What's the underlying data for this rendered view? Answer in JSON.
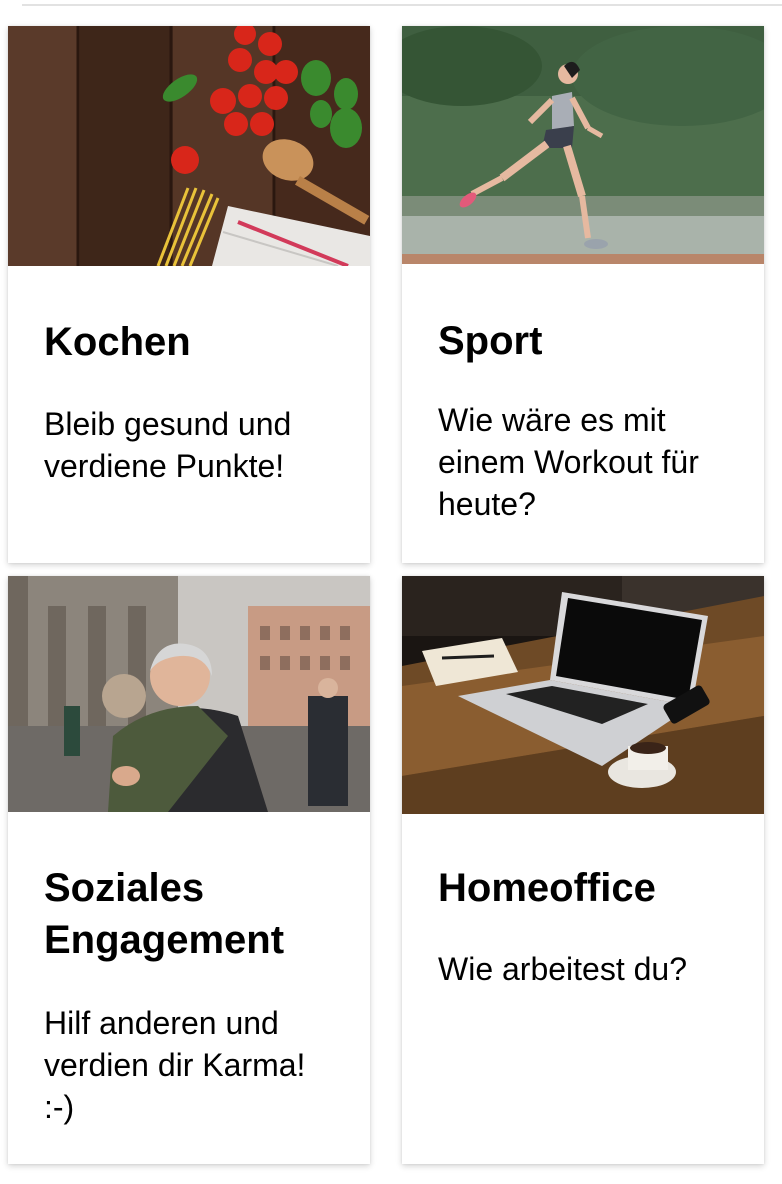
{
  "cards": [
    {
      "title": "Kochen",
      "text": "Bleib gesund und verdiene Punkte!",
      "image": "cooking-ingredients-photo"
    },
    {
      "title": "Sport",
      "text": "Wie wäre es mit einem Workout für heute?",
      "image": "woman-running-photo"
    },
    {
      "title": "Soziales Engagement",
      "text": "Hilf anderen und verdien dir Karma! :-)",
      "image": "people-hugging-photo"
    },
    {
      "title": "Homeoffice",
      "text": "Wie arbeitest du?",
      "image": "laptop-on-desk-photo"
    }
  ]
}
